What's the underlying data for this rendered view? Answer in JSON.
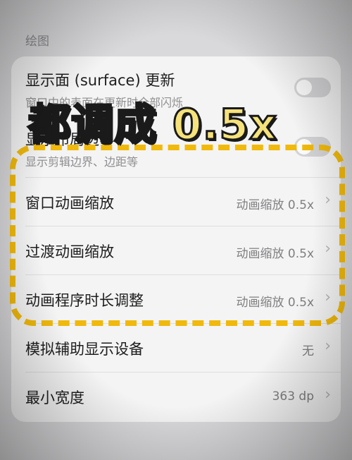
{
  "section": {
    "title": "绘图"
  },
  "rows": [
    {
      "title": "显示面 (surface) 更新",
      "subtitle": "窗口中的表面在更新时全部闪烁",
      "toggle": "off"
    },
    {
      "title": "显示布局边界",
      "subtitle": "显示剪辑边界、边距等",
      "toggle": "off"
    },
    {
      "title": "窗口动画缩放",
      "value": "动画缩放 0.5x"
    },
    {
      "title": "过渡动画缩放",
      "value": "动画缩放 0.5x"
    },
    {
      "title": "动画程序时长调整",
      "value": "动画缩放 0.5x"
    },
    {
      "title": "模拟辅助显示设备",
      "value": "无"
    },
    {
      "title": "最小宽度",
      "value": "363 dp"
    }
  ],
  "overlay": {
    "text": "都调成 0.5x"
  },
  "chevron": "›",
  "colors": {
    "highlight": "#f0b90b",
    "overlay_fill": "#f6e27a"
  }
}
